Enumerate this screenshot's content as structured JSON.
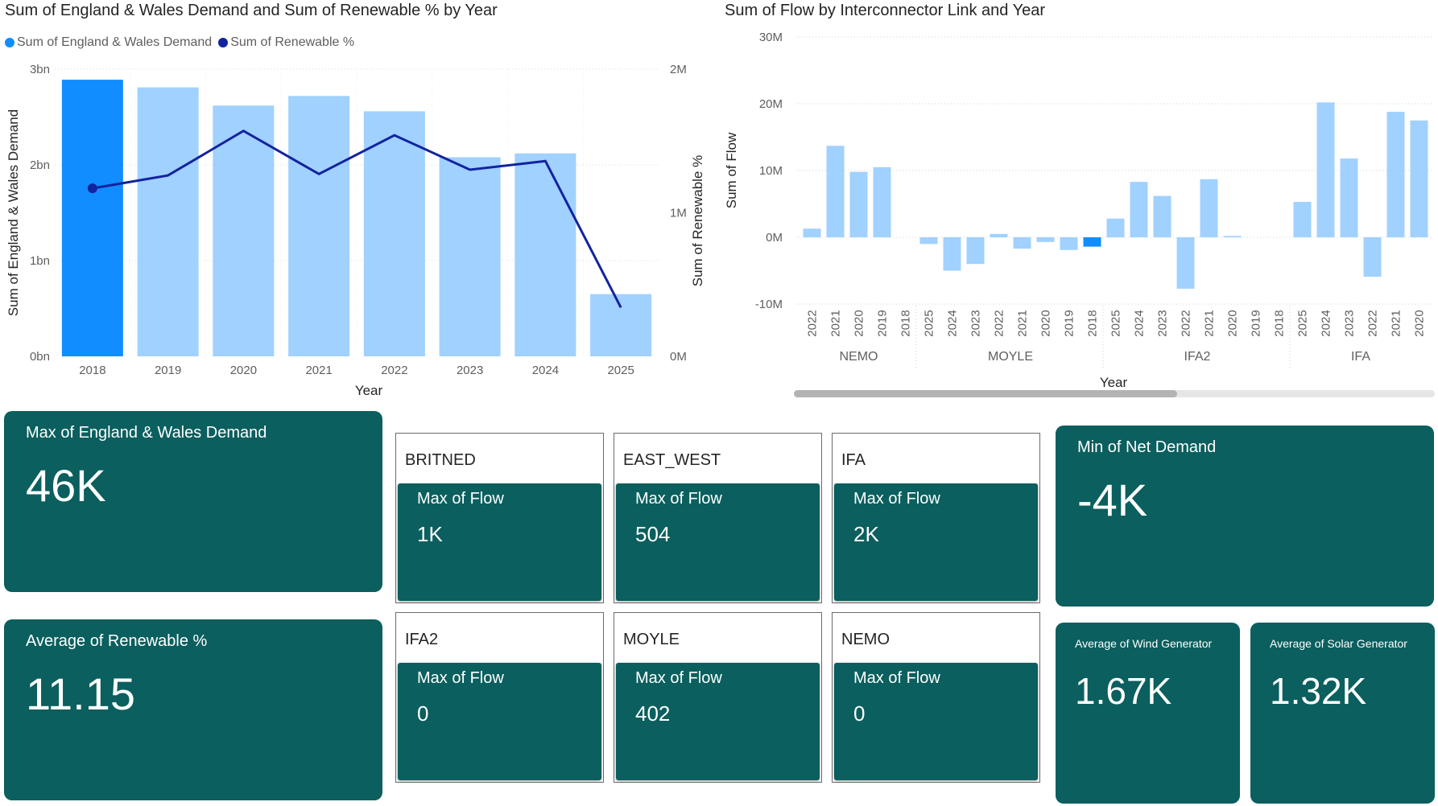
{
  "chart1": {
    "title": "Sum of England & Wales Demand and Sum of Renewable % by Year",
    "legend": [
      {
        "label": "Sum of England & Wales Demand",
        "color": "#118dff"
      },
      {
        "label": "Sum of Renewable %",
        "color": "#12239e"
      }
    ]
  },
  "chart2": {
    "title": "Sum of Flow by Interconnector Link and Year"
  },
  "chart_data": [
    {
      "type": "bar",
      "subtype": "combo bar + line",
      "title": "Sum of England & Wales Demand and Sum of Renewable % by Year",
      "categories": [
        "2018",
        "2019",
        "2020",
        "2021",
        "2022",
        "2023",
        "2024",
        "2025"
      ],
      "xlabel": "Year",
      "ylabel": "Sum of England & Wales Demand",
      "y2label": "Sum of Renewable %",
      "y_ticks": [
        "0bn",
        "1bn",
        "2bn",
        "3bn"
      ],
      "y2_ticks": [
        "0M",
        "1M",
        "2M"
      ],
      "ylim": [
        0,
        3000000000
      ],
      "y2lim": [
        0,
        2000000
      ],
      "series": [
        {
          "name": "Sum of England & Wales Demand",
          "kind": "bar",
          "color": "#118dff",
          "highlight_color": "#118dff",
          "faded_color": "#a0d1ff",
          "values": [
            2890000000,
            2810000000,
            2620000000,
            2720000000,
            2560000000,
            2080000000,
            2120000000,
            650000000
          ],
          "highlighted": [
            true,
            false,
            false,
            false,
            false,
            false,
            false,
            false
          ]
        },
        {
          "name": "Sum of Renewable %",
          "kind": "line",
          "color": "#12239e",
          "values": [
            1170000,
            1260000,
            1570000,
            1270000,
            1540000,
            1300000,
            1360000,
            340000
          ]
        }
      ],
      "grid": true,
      "legend": "top-left"
    },
    {
      "type": "bar",
      "title": "Sum of Flow by Interconnector Link and Year",
      "xlabel": "Year",
      "ylabel": "Sum of Flow",
      "y_ticks": [
        "-10M",
        "0M",
        "10M",
        "20M",
        "30M"
      ],
      "ylim": [
        -10000000,
        30000000
      ],
      "color": "#a0d1ff",
      "highlight_color": "#118dff",
      "groups": [
        {
          "name": "NEMO",
          "categories": [
            "2022",
            "2021",
            "2020",
            "2019",
            "2018"
          ],
          "values": [
            1300000,
            13700000,
            9800000,
            10500000,
            0
          ]
        },
        {
          "name": "MOYLE",
          "categories": [
            "2025",
            "2024",
            "2023",
            "2022",
            "2021",
            "2020",
            "2019",
            "2018"
          ],
          "values": [
            -1000000,
            -5000000,
            -4000000,
            500000,
            -1700000,
            -700000,
            -1900000,
            -1400000
          ],
          "highlighted": [
            false,
            false,
            false,
            false,
            false,
            false,
            false,
            true
          ]
        },
        {
          "name": "IFA2",
          "categories": [
            "2025",
            "2024",
            "2023",
            "2022",
            "2021",
            "2020",
            "2019",
            "2018"
          ],
          "values": [
            2800000,
            8300000,
            6200000,
            -7700000,
            8700000,
            200000,
            0,
            0
          ]
        },
        {
          "name": "IFA",
          "categories": [
            "2025",
            "2024",
            "2023",
            "2022",
            "2021",
            "2020"
          ],
          "values": [
            5300000,
            20200000,
            11800000,
            -5900000,
            18800000,
            17500000
          ]
        }
      ],
      "grid": true
    }
  ],
  "cards": {
    "max_demand": {
      "label": "Max of England & Wales Demand",
      "value": "46K"
    },
    "avg_renewable": {
      "label": "Average of Renewable %",
      "value": "11.15"
    },
    "min_net_demand": {
      "label": "Min of Net Demand",
      "value": "-4K"
    },
    "avg_wind": {
      "label": "Average of Wind Generator",
      "value": "1.67K"
    },
    "avg_solar": {
      "label": "Average of Solar Generator",
      "value": "1.32K"
    }
  },
  "links": [
    {
      "name": "BRITNED",
      "measure": "Max of Flow",
      "value": "1K"
    },
    {
      "name": "EAST_WEST",
      "measure": "Max of Flow",
      "value": "504"
    },
    {
      "name": "IFA",
      "measure": "Max of Flow",
      "value": "2K"
    },
    {
      "name": "IFA2",
      "measure": "Max of Flow",
      "value": "0"
    },
    {
      "name": "MOYLE",
      "measure": "Max of Flow",
      "value": "402"
    },
    {
      "name": "NEMO",
      "measure": "Max of Flow",
      "value": "0"
    }
  ]
}
